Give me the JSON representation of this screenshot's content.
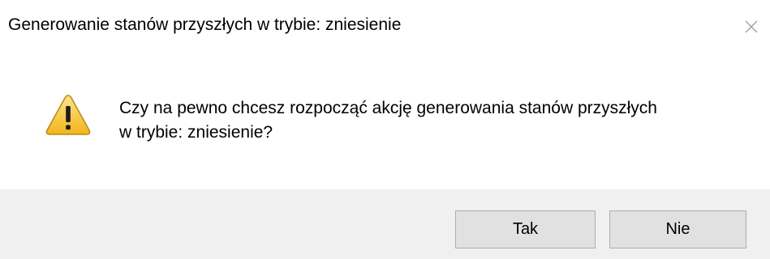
{
  "dialog": {
    "title": "Generowanie stanów przyszłych w trybie: zniesienie",
    "close_icon": "close-icon",
    "icon": "warning-icon",
    "message_line1": "Czy na pewno chcesz rozpocząć akcję generowania stanów przyszłych",
    "message_line2": "w trybie: zniesienie?"
  },
  "buttons": {
    "yes_label": "Tak",
    "no_label": "Nie"
  },
  "colors": {
    "warning_fill": "#f7c82a",
    "warning_border": "#b78a12",
    "footer_bg": "#f0f0f0"
  }
}
